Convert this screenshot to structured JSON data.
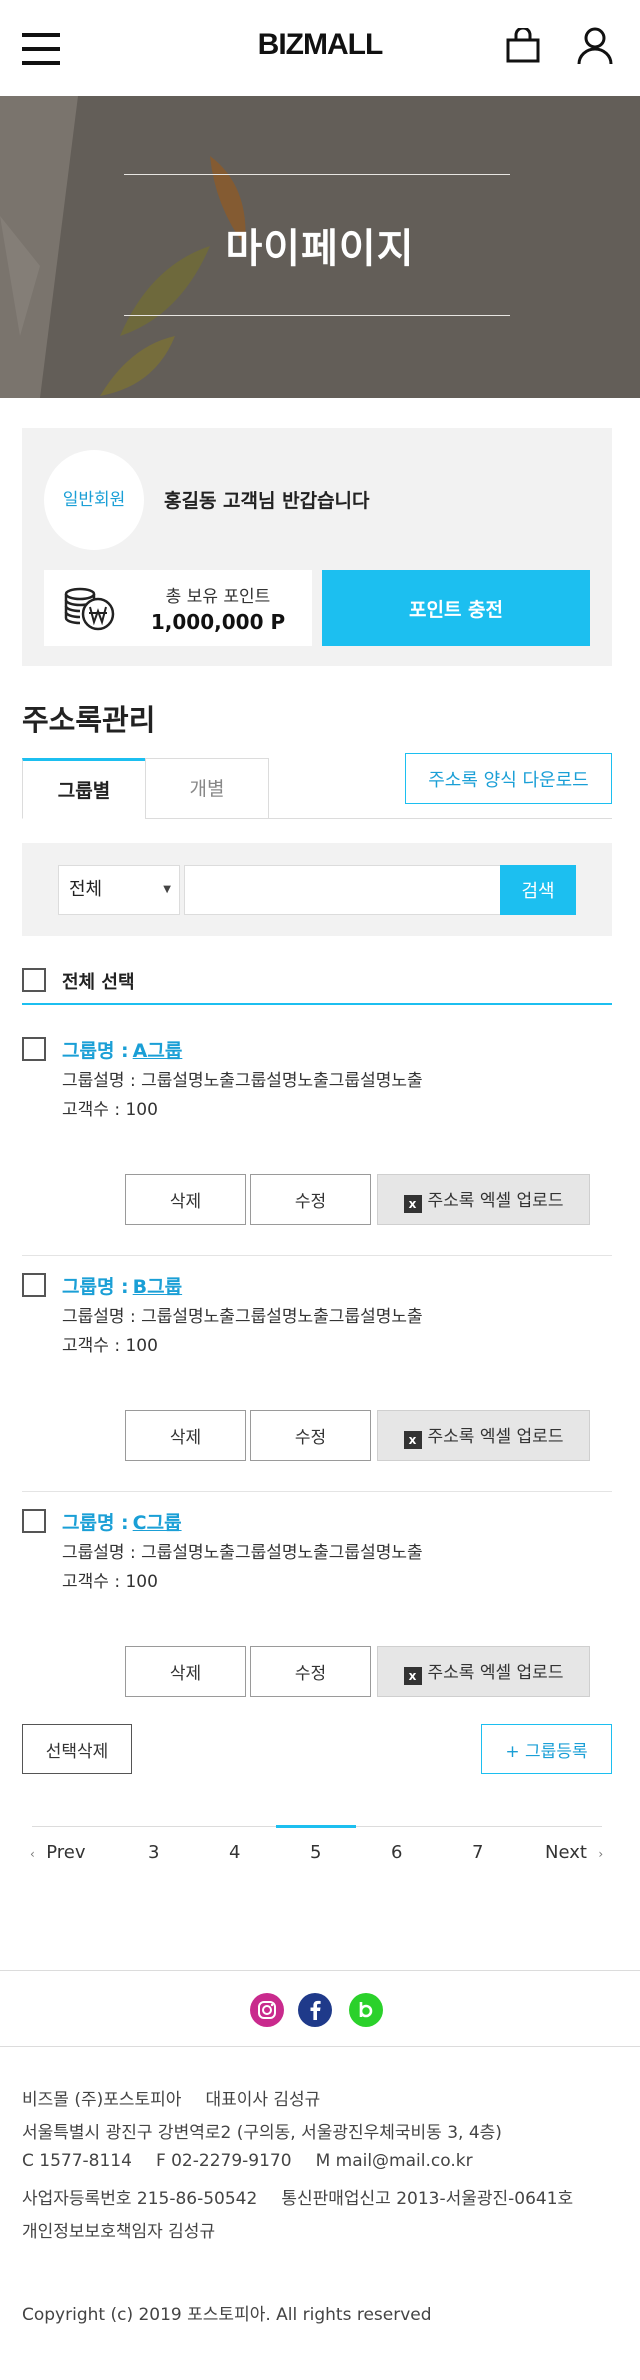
{
  "header": {
    "logo": "BIZMALL",
    "menu_icon": "hamburger-menu-icon",
    "cart_icon": "shopping-bag-icon",
    "user_icon": "user-icon"
  },
  "hero": {
    "title": "마이페이지"
  },
  "member": {
    "grade": "일반회원",
    "greeting": "홍길동 고객님 반갑습니다",
    "point_label": "총 보유 포인트",
    "point_value": "1,000,000 P",
    "charge_label": "포인트 충전"
  },
  "address_book": {
    "title": "주소록관리",
    "tabs": [
      {
        "label": "그룹별",
        "active": true
      },
      {
        "label": "개별",
        "active": false
      }
    ],
    "download_label": "주소록 양식 다운로드",
    "search": {
      "select_value": "전체",
      "input_value": "",
      "button_label": "검색"
    },
    "select_all_label": "전체 선택",
    "groups": [
      {
        "name_label": "그룹명 :",
        "name": "A그룹",
        "desc_label": "그룹설명 :",
        "desc": "그룹설명노출그룹설명노출그룹설명노출",
        "count_label": "고객수 :",
        "count": "100",
        "delete_label": "삭제",
        "edit_label": "수정",
        "excel_icon": "x",
        "excel_label": "주소록 엑셀 업로드"
      },
      {
        "name_label": "그룹명 :",
        "name": "B그룹",
        "desc_label": "그룹설명 :",
        "desc": "그룹설명노출그룹설명노출그룹설명노출",
        "count_label": "고객수 :",
        "count": "100",
        "delete_label": "삭제",
        "edit_label": "수정",
        "excel_icon": "x",
        "excel_label": "주소록 엑셀 업로드"
      },
      {
        "name_label": "그룹명 :",
        "name": "C그룹",
        "desc_label": "그룹설명 :",
        "desc": "그룹설명노출그룹설명노출그룹설명노출",
        "count_label": "고객수 :",
        "count": "100",
        "delete_label": "삭제",
        "edit_label": "수정",
        "excel_icon": "x",
        "excel_label": "주소록 엑셀 업로드"
      }
    ],
    "select_delete_label": "선택삭제",
    "add_group_label": "+ 그룹등록"
  },
  "pagination": {
    "prev": "Prev",
    "pages": [
      "3",
      "4",
      "5",
      "6",
      "7"
    ],
    "active": "5",
    "next": "Next"
  },
  "footer": {
    "sns": [
      "instagram-icon",
      "facebook-icon",
      "blog-icon"
    ],
    "info": [
      [
        "비즈몰 (주)포스토피아",
        "대표이사 김성규"
      ],
      [
        "서울특별시 광진구 강변역로2 (구의동, 서울광진우체국비동 3, 4층)"
      ],
      [
        "C 1577-8114",
        "F 02-2279-9170",
        "M mail@mail.co.kr"
      ],
      [
        "사업자등록번호 215-86-50542",
        "통신판매업신고 2013-서울광진-0641호"
      ],
      [
        "개인정보보호책임자 김성규"
      ]
    ],
    "copyright": "Copyright (c) 2019 포스토피아. All rights reserved"
  },
  "colors": {
    "accent": "#1cbff0",
    "link": "#1a9fd6",
    "hero_bg": "#635e58",
    "box_bg": "#f2f2f2"
  }
}
